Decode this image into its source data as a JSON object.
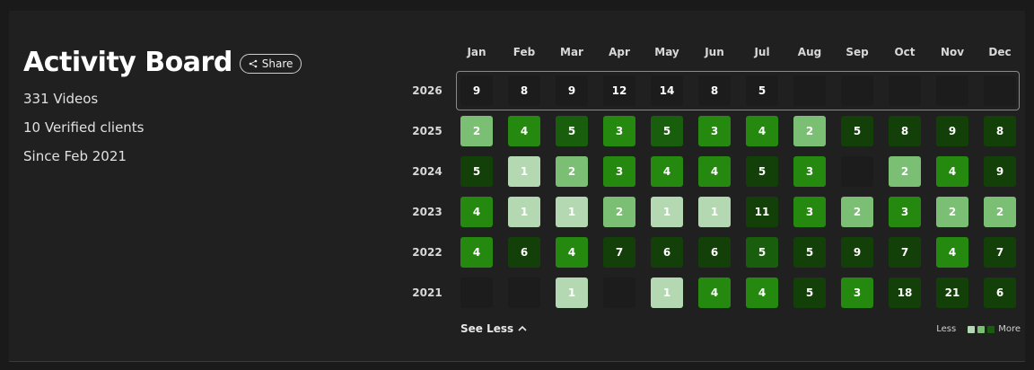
{
  "header": {
    "title": "Activity Board",
    "share_label": "Share",
    "stats": [
      "331 Videos",
      "10 Verified clients",
      "Since Feb 2021"
    ]
  },
  "board": {
    "months": [
      "Jan",
      "Feb",
      "Mar",
      "Apr",
      "May",
      "Jun",
      "Jul",
      "Aug",
      "Sep",
      "Oct",
      "Nov",
      "Dec"
    ],
    "rows": [
      {
        "year": "2026",
        "values": [
          9,
          8,
          9,
          12,
          14,
          8,
          5,
          null,
          null,
          null,
          null,
          null
        ],
        "highlighted": true
      },
      {
        "year": "2025",
        "values": [
          2,
          4,
          5,
          3,
          5,
          3,
          4,
          2,
          5,
          8,
          9,
          8
        ]
      },
      {
        "year": "2024",
        "values": [
          5,
          1,
          2,
          3,
          4,
          4,
          5,
          3,
          null,
          2,
          4,
          9
        ]
      },
      {
        "year": "2023",
        "values": [
          4,
          1,
          1,
          2,
          1,
          1,
          11,
          3,
          2,
          3,
          2,
          2
        ]
      },
      {
        "year": "2022",
        "values": [
          4,
          6,
          4,
          7,
          6,
          6,
          5,
          5,
          9,
          7,
          4,
          7
        ]
      },
      {
        "year": "2021",
        "values": [
          null,
          null,
          1,
          null,
          1,
          4,
          4,
          5,
          3,
          18,
          21,
          6
        ]
      }
    ],
    "levels": [
      [
        0,
        0,
        0,
        0,
        0,
        0,
        0,
        0,
        0,
        0,
        0,
        0
      ],
      [
        2,
        3,
        4,
        3,
        4,
        3,
        3,
        2,
        5,
        5,
        5,
        5
      ],
      [
        5,
        1,
        2,
        3,
        3,
        3,
        5,
        3,
        0,
        2,
        3,
        5
      ],
      [
        3,
        1,
        1,
        2,
        1,
        1,
        5,
        3,
        2,
        3,
        2,
        2
      ],
      [
        3,
        5,
        3,
        5,
        5,
        5,
        4,
        5,
        5,
        5,
        3,
        5
      ],
      [
        0,
        0,
        1,
        0,
        1,
        3,
        3,
        5,
        3,
        5,
        5,
        5
      ]
    ],
    "level_colors": [
      "#1c1c1c",
      "#b4d9b2",
      "#7abf73",
      "#25880f",
      "#195e0c",
      "#133f08"
    ]
  },
  "footer": {
    "see_less_label": "See Less",
    "legend_less": "Less",
    "legend_more": "More",
    "legend_colors": [
      "#b4d9b2",
      "#7abf73",
      "#195e0c"
    ]
  }
}
